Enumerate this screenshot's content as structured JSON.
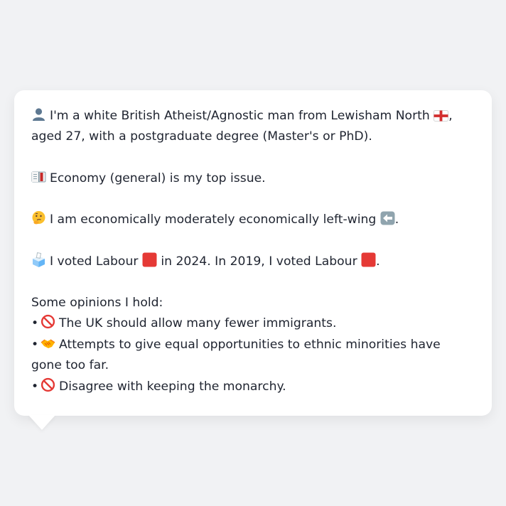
{
  "persona": {
    "intro": {
      "icon": "person-silhouette-icon",
      "text_before_flag": "I'm a white British Atheist/Agnostic man from Lewisham North",
      "flag_icon": "england-flag-icon",
      "text_after_flag": ", aged 27, with a postgraduate degree (Master's or PhD)."
    },
    "issue": {
      "icon": "ledger-book-icon",
      "text": "Economy (general) is my top issue."
    },
    "economics": {
      "icon": "thinking-face-icon",
      "text": "I am economically moderately economically left-wing",
      "direction_icon": "left-arrow-icon",
      "suffix": "."
    },
    "votes": {
      "icon": "ballot-box-icon",
      "text1": "I voted Labour",
      "party_color": "#e53935",
      "text2": "in 2024. In 2019, I voted Labour",
      "suffix": "."
    },
    "opinions_heading": "Some opinions I hold:",
    "opinions": [
      {
        "bullet": "•",
        "icon": "no-entry-icon",
        "text": "The UK should allow many fewer immigrants."
      },
      {
        "bullet": "•",
        "icon": "handshake-icon",
        "text": "Attempts to give equal opportunities to ethnic minorities have gone too far."
      },
      {
        "bullet": "•",
        "icon": "no-entry-icon",
        "text": "Disagree with keeping the monarchy."
      }
    ]
  }
}
